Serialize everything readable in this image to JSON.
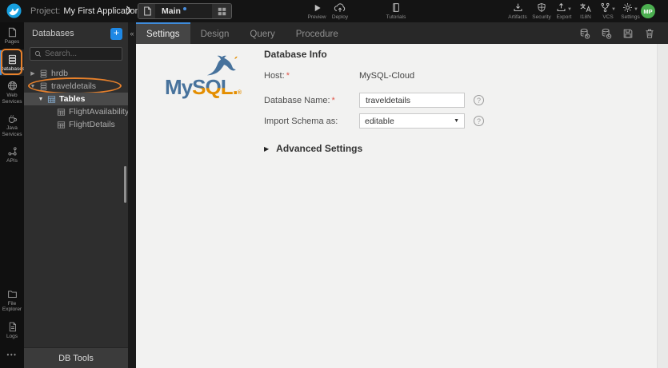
{
  "topbar": {
    "project_label": "Project:",
    "project_name": "My First Application",
    "page_name": "Main",
    "preview": "Preview",
    "deploy": "Deploy",
    "tutorials": "Tutorials",
    "artifacts": "Artifacts",
    "security": "Security",
    "export": "Export",
    "i18n": "I18N",
    "vcs": "VCS",
    "settings": "Settings",
    "avatar": "MP"
  },
  "sidebar": {
    "pages": "Pages",
    "databases": "Databases",
    "web_services": "Web Services",
    "java_services": "Java Services",
    "apis": "APIs",
    "file_explorer": "File Explorer",
    "logs": "Logs",
    "more": "•••"
  },
  "panel": {
    "title": "Databases",
    "add": "+",
    "collapse": "«",
    "search_placeholder": "Search...",
    "tree": [
      {
        "label": "hrdb"
      },
      {
        "label": "traveldetails"
      },
      {
        "label": "Tables"
      },
      {
        "label": "FlightAvailability"
      },
      {
        "label": "FlightDetails"
      }
    ],
    "footer": "DB Tools"
  },
  "tabs": [
    "Settings",
    "Design",
    "Query",
    "Procedure"
  ],
  "content": {
    "logo_my": "My",
    "logo_sql": "SQL",
    "logo_dot": ".",
    "logo_reg": "®",
    "section_title": "Database Info",
    "required_mark": "*",
    "host_label": "Host:",
    "host_value": "MySQL-Cloud",
    "dbname_label": "Database Name:",
    "dbname_value": "traveldetails",
    "import_label": "Import Schema as:",
    "import_value": "editable",
    "select_caret": "▼",
    "advanced_label": "Advanced Settings",
    "help": "?"
  },
  "colors": {
    "accent_blue": "#3f8cdb",
    "annotation_orange": "#e8812b",
    "avatar_green": "#4caf50",
    "mysql_blue": "#47729c",
    "mysql_orange": "#e48e00"
  }
}
